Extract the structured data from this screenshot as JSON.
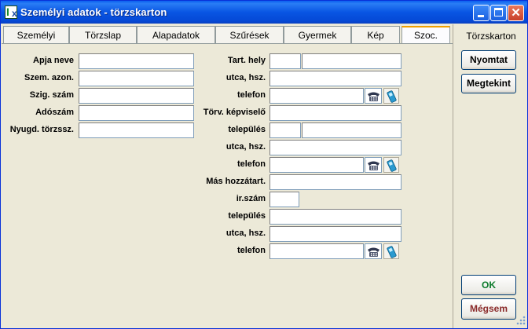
{
  "window": {
    "title": "Személyi adatok - törzskarton"
  },
  "tabs": [
    {
      "label": "Személyi"
    },
    {
      "label": "Törzslap"
    },
    {
      "label": "Alapadatok"
    },
    {
      "label": "Szűrések"
    },
    {
      "label": "Gyermek"
    },
    {
      "label": "Kép"
    },
    {
      "label": "Szoc."
    }
  ],
  "left_form": {
    "father_name_label": "Apja neve",
    "personal_id_label": "Szem. azon.",
    "id_card_label": "Szig. szám",
    "tax_number_label": "Adószám",
    "pension_id_label": "Nyugd. törzssz."
  },
  "middle_form": {
    "residence_label": "Tart. hely",
    "street_1_label": "utca, hsz.",
    "phone_1_label": "telefon",
    "legal_rep_label": "Törv. képviselő",
    "settlement_1_label": "település",
    "street_2_label": "utca, hsz.",
    "phone_2_label": "telefon",
    "other_relative_label": "Más hozzátart.",
    "zip_label": "ir.szám",
    "settlement_2_label": "település",
    "street_3_label": "utca, hsz.",
    "phone_3_label": "telefon"
  },
  "side_panel": {
    "title": "Törzskarton",
    "print_label": "Nyomtat",
    "view_label": "Megtekint",
    "ok_label": "OK",
    "cancel_label": "Mégsem"
  },
  "colors": {
    "titlebar": "#0a5ff0",
    "ok_text": "#0a7a2a",
    "cancel_text": "#8a2a2a",
    "active_tab_accent": "#f0a000"
  },
  "icons": {
    "phone": "telephone-icon",
    "mobile": "mobile-phone-icon",
    "app": "app-icon"
  }
}
